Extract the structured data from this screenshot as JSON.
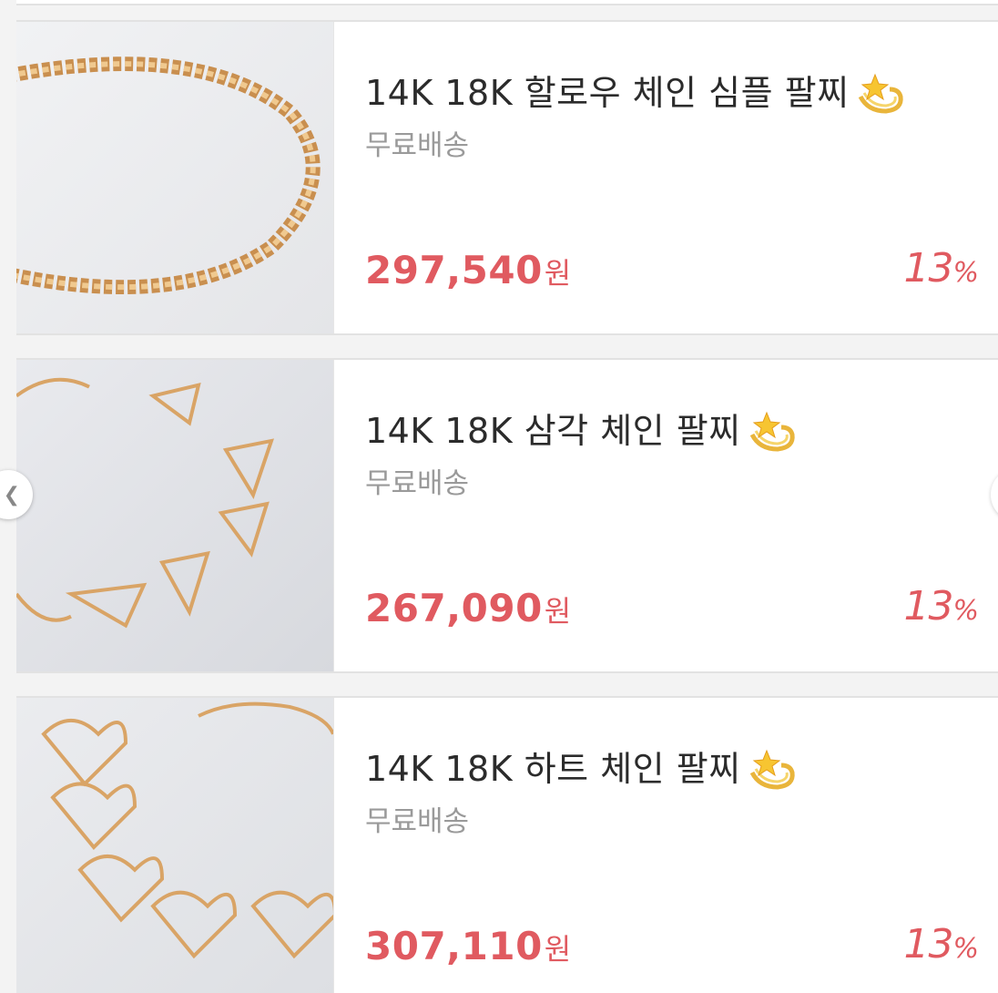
{
  "products": [
    {
      "title": "14K 18K 할로우 체인 심플 팔찌",
      "shipping": "무료배송",
      "price": "297,540",
      "currency": "원",
      "discount": "13",
      "discount_unit": "%",
      "image_desc": "gold curb chain bracelet"
    },
    {
      "title": "14K 18K 삼각 체인 팔찌",
      "shipping": "무료배송",
      "price": "267,090",
      "currency": "원",
      "discount": "13",
      "discount_unit": "%",
      "image_desc": "gold triangle link bracelet"
    },
    {
      "title": "14K 18K 하트 체인 팔찌",
      "shipping": "무료배송",
      "price": "307,110",
      "currency": "원",
      "discount": "13",
      "discount_unit": "%",
      "image_desc": "gold heart link bracelet"
    }
  ],
  "icons": {
    "title_emoji": "dizzy-star-icon",
    "prev": "chevron-left-icon"
  },
  "colors": {
    "price": "#e05a60",
    "gold": "#d9a466"
  }
}
